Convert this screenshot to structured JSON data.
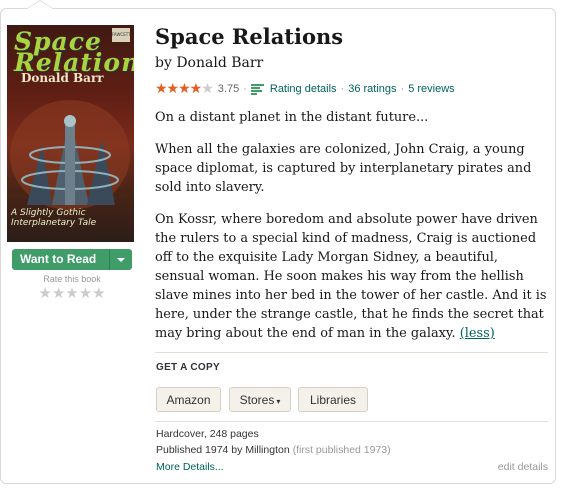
{
  "book": {
    "title": "Space Relations",
    "by_prefix": "by",
    "author": "Donald Barr",
    "average_rating": "3.75",
    "rating_details": "Rating details",
    "ratings": "36 ratings",
    "reviews": "5 reviews",
    "stars": 3.75
  },
  "cover": {
    "title_line1": "Space",
    "title_line2": "Relations",
    "author": "Donald Barr",
    "tagline_line1": "A Slightly Gothic",
    "tagline_line2": "Interplanetary Tale",
    "publisher_mark": "FAWCETT"
  },
  "shelf": {
    "want_to_read": "Want to Read",
    "rate_label": "Rate this book",
    "rate_stars": "★★★★★"
  },
  "description": {
    "p1": "On a distant planet in the distant future...",
    "p2": "When all the galaxies are colonized, John Craig, a young space diplomat, is captured by interplanetary pirates and sold into slavery.",
    "p3": "On Kossr, where boredom and absolute power have driven the rulers to a special kind of madness, Craig is auctioned off to the exquisite Lady Morgan Sidney, a beautiful, sensual woman. He soon makes his way from the hellish slave mines into her bed in the tower of her castle. And it is here, under the strange castle, that he finds the secret that may bring about the end of man in the galaxy.",
    "less_link": "(less)"
  },
  "get_a_copy": {
    "heading": "GET A COPY",
    "amazon": "Amazon",
    "stores": "Stores",
    "libraries": "Libraries"
  },
  "details": {
    "format": "Hardcover, 248 pages",
    "published": "Published 1974 by Millington",
    "first_published": "(first published 1973)",
    "more_details": "More Details...",
    "edit_details": "edit details"
  },
  "colors": {
    "green_button": "#409d69",
    "link": "#00635d",
    "star": "#e85d20"
  }
}
